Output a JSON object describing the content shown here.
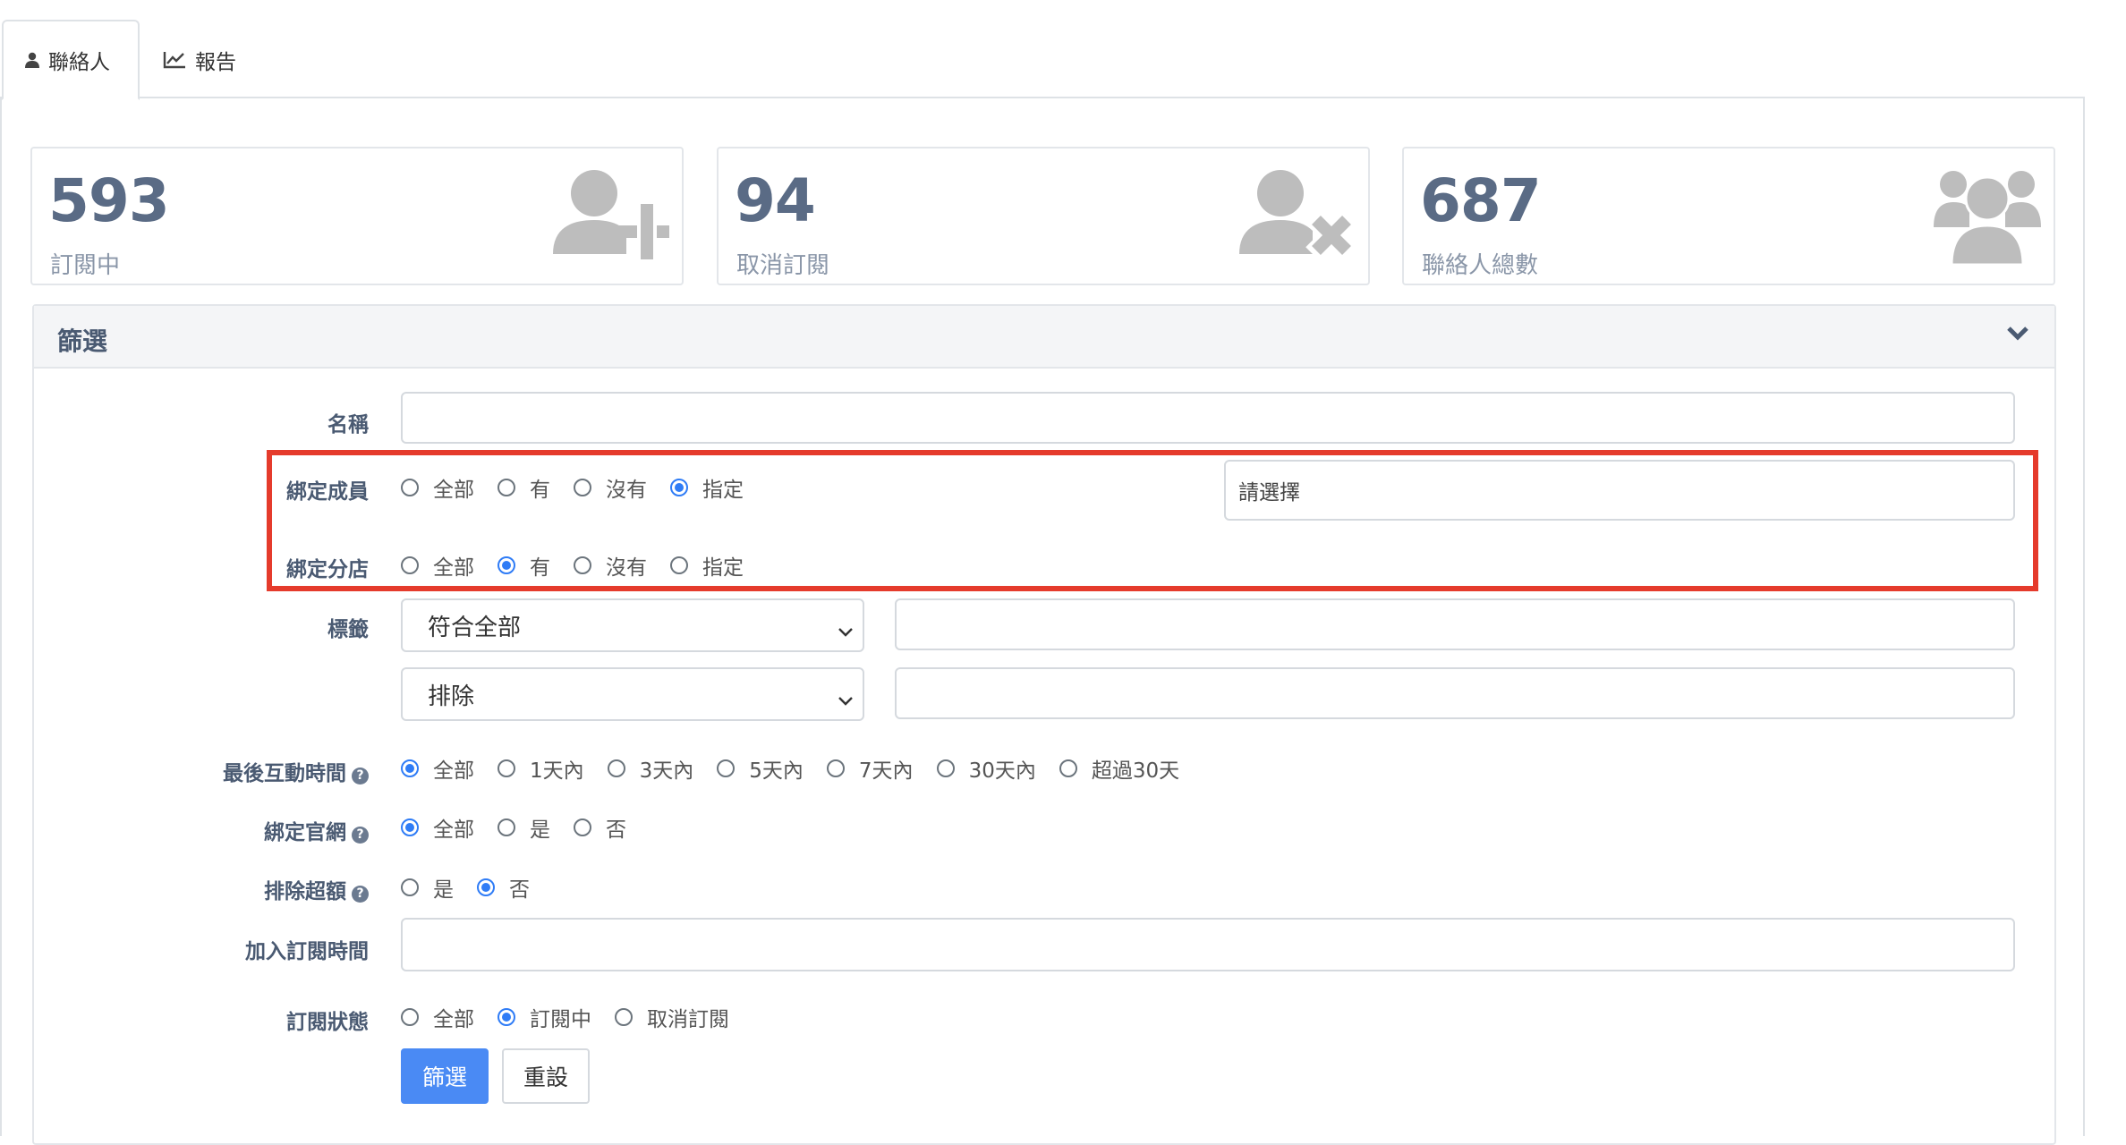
{
  "tabs": [
    {
      "label": "聯絡人",
      "icon": "user-icon",
      "active": true
    },
    {
      "label": "報告",
      "icon": "line-chart-icon",
      "active": false
    }
  ],
  "stats": [
    {
      "value": "593",
      "label": "訂閱中",
      "icon": "user-plus-icon"
    },
    {
      "value": "94",
      "label": "取消訂閱",
      "icon": "user-times-icon"
    },
    {
      "value": "687",
      "label": "聯絡人總數",
      "icon": "users-icon"
    }
  ],
  "filter": {
    "title": "篩選",
    "name": {
      "label": "名稱",
      "value": ""
    },
    "bind_member": {
      "label": "綁定成員",
      "options": [
        "全部",
        "有",
        "沒有",
        "指定"
      ],
      "selected": "指定",
      "select_placeholder": "請選擇"
    },
    "bind_branch": {
      "label": "綁定分店",
      "options": [
        "全部",
        "有",
        "沒有",
        "指定"
      ],
      "selected": "有"
    },
    "tags": {
      "label": "標籤",
      "match_select": "符合全部",
      "exclude_select": "排除",
      "match_value": "",
      "exclude_value": ""
    },
    "last_interaction": {
      "label": "最後互動時間",
      "options": [
        "全部",
        "1天內",
        "3天內",
        "5天內",
        "7天內",
        "30天內",
        "超過30天"
      ],
      "selected": "全部"
    },
    "bind_website": {
      "label": "綁定官網",
      "options": [
        "全部",
        "是",
        "否"
      ],
      "selected": "全部"
    },
    "exclude_over": {
      "label": "排除超額",
      "options": [
        "是",
        "否"
      ],
      "selected": "否"
    },
    "join_time": {
      "label": "加入訂閱時間",
      "value": ""
    },
    "sub_status": {
      "label": "訂閱狀態",
      "options": [
        "全部",
        "訂閱中",
        "取消訂閱"
      ],
      "selected": "訂閱中"
    },
    "submit_label": "篩選",
    "reset_label": "重設"
  },
  "colors": {
    "accent": "#4a8af4",
    "highlight_border": "#e53b2c",
    "stat_number": "#5a6b85"
  }
}
